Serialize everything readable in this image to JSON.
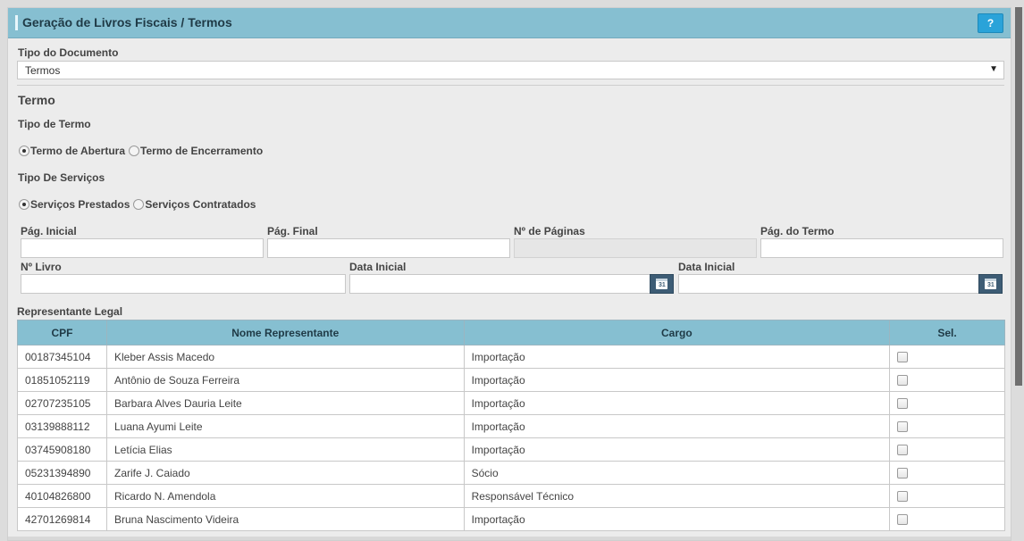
{
  "header": {
    "title": "Geração de Livros Fiscais / Termos",
    "help_label": "?"
  },
  "tipo_documento": {
    "label": "Tipo do Documento",
    "value": "Termos"
  },
  "termo": {
    "section_title": "Termo",
    "tipo_termo_label": "Tipo de Termo",
    "tipo_termo_options": [
      "Termo de Abertura",
      "Termo de Encerramento"
    ],
    "tipo_termo_selected": "Termo de Abertura",
    "tipo_servicos_label": "Tipo De Serviços",
    "tipo_servicos_options": [
      "Serviços Prestados",
      "Serviços Contratados"
    ],
    "tipo_servicos_selected": "Serviços Prestados"
  },
  "fields": {
    "pag_inicial": "Pág. Inicial",
    "pag_final": "Pág. Final",
    "num_paginas": "Nº de Páginas",
    "pag_termo": "Pág. do Termo",
    "num_livro": "Nº Livro",
    "data_inicial_1": "Data Inicial",
    "data_inicial_2": "Data Inicial",
    "calendar_day": "31"
  },
  "representante": {
    "label": "Representante Legal",
    "columns": [
      "CPF",
      "Nome Representante",
      "Cargo",
      "Sel."
    ],
    "rows": [
      [
        "00187345104",
        "Kleber Assis Macedo",
        "Importação"
      ],
      [
        "01851052119",
        "Antônio de Souza Ferreira",
        "Importação"
      ],
      [
        "02707235105",
        "Barbara Alves Dauria Leite",
        "Importação"
      ],
      [
        "03139888112",
        "Luana Ayumi Leite",
        "Importação"
      ],
      [
        "03745908180",
        "Letícia Elias",
        "Importação"
      ],
      [
        "05231394890",
        "Zarife J. Caiado",
        "Sócio"
      ],
      [
        "40104826800",
        "Ricardo N. Amendola",
        "Responsável Técnico"
      ],
      [
        "42701269814",
        "Bruna Nascimento Videira",
        "Importação"
      ]
    ]
  },
  "colors": {
    "header": "#86bfd1",
    "help": "#2aa3d9",
    "calendar": "#3d5c75"
  },
  "icons": {
    "help": "question-icon",
    "calendar": "calendar-icon",
    "dropdown": "chevron-down-icon"
  }
}
